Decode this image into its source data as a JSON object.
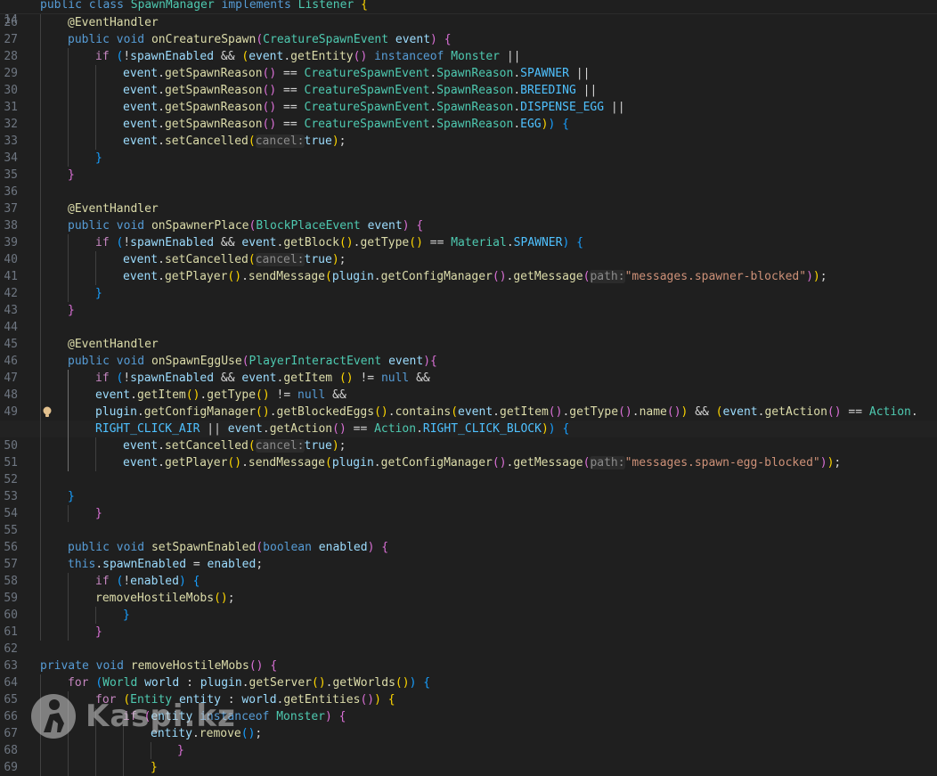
{
  "sticky": {
    "line_number": "14",
    "text": "public class SpawnManager implements Listener {"
  },
  "lines": [
    {
      "n": "26",
      "t": "@EventHandler"
    },
    {
      "n": "27",
      "t": "public void onCreatureSpawn(CreatureSpawnEvent event) {"
    },
    {
      "n": "28",
      "t": "if (!spawnEnabled && (event.getEntity() instanceof Monster ||"
    },
    {
      "n": "29",
      "t": "event.getSpawnReason() == CreatureSpawnEvent.SpawnReason.SPAWNER ||"
    },
    {
      "n": "30",
      "t": "event.getSpawnReason() == CreatureSpawnEvent.SpawnReason.BREEDING ||"
    },
    {
      "n": "31",
      "t": "event.getSpawnReason() == CreatureSpawnEvent.SpawnReason.DISPENSE_EGG ||"
    },
    {
      "n": "32",
      "t": "event.getSpawnReason() == CreatureSpawnEvent.SpawnReason.EGG)) {"
    },
    {
      "n": "33",
      "t": "event.setCancelled(cancel:true);"
    },
    {
      "n": "34",
      "t": "}"
    },
    {
      "n": "35",
      "t": "}"
    },
    {
      "n": "36",
      "t": ""
    },
    {
      "n": "37",
      "t": "@EventHandler"
    },
    {
      "n": "38",
      "t": "public void onSpawnerPlace(BlockPlaceEvent event) {"
    },
    {
      "n": "39",
      "t": "if (!spawnEnabled && event.getBlock().getType() == Material.SPAWNER) {"
    },
    {
      "n": "40",
      "t": "event.setCancelled(cancel:true);"
    },
    {
      "n": "41",
      "t": "event.getPlayer().sendMessage(plugin.getConfigManager().getMessage(path:\"messages.spawner-blocked\"));"
    },
    {
      "n": "42",
      "t": "}"
    },
    {
      "n": "43",
      "t": "}"
    },
    {
      "n": "44",
      "t": ""
    },
    {
      "n": "45",
      "t": "@EventHandler"
    },
    {
      "n": "46",
      "t": "public void onSpawnEggUse(PlayerInteractEvent event){"
    },
    {
      "n": "47",
      "t": "if (!spawnEnabled && event.getItem () != null &&"
    },
    {
      "n": "48",
      "t": "event.getItem().getType() != null &&"
    },
    {
      "n": "49",
      "t": "plugin.getConfigManager().getBlockedEggs().contains(event.getItem().getType().name()) && (event.getAction() == Action."
    },
    {
      "n": "",
      "t": "RIGHT_CLICK_AIR || event.getAction() == Action.RIGHT_CLICK_BLOCK)) {"
    },
    {
      "n": "50",
      "t": "event.setCancelled(cancel:true);"
    },
    {
      "n": "51",
      "t": "event.getPlayer().sendMessage(plugin.getConfigManager().getMessage(path:\"messages.spawn-egg-blocked\"));"
    },
    {
      "n": "52",
      "t": ""
    },
    {
      "n": "53",
      "t": "}"
    },
    {
      "n": "54",
      "t": "}"
    },
    {
      "n": "55",
      "t": ""
    },
    {
      "n": "56",
      "t": "public void setSpawnEnabled(boolean enabled) {"
    },
    {
      "n": "57",
      "t": "this.spawnEnabled = enabled;"
    },
    {
      "n": "58",
      "t": "if (!enabled) {"
    },
    {
      "n": "59",
      "t": "removeHostileMobs();"
    },
    {
      "n": "60",
      "t": "}"
    },
    {
      "n": "61",
      "t": "}"
    },
    {
      "n": "62",
      "t": ""
    },
    {
      "n": "63",
      "t": "private void removeHostileMobs() {"
    },
    {
      "n": "64",
      "t": "for (World world : plugin.getServer().getWorlds()) {"
    },
    {
      "n": "65",
      "t": "for (Entity entity : world.getEntities()) {"
    },
    {
      "n": "66",
      "t": "if (entity instanceof Monster) {"
    },
    {
      "n": "67",
      "t": "entity.remove();"
    },
    {
      "n": "68",
      "t": "}"
    },
    {
      "n": "69",
      "t": "}"
    }
  ],
  "watermark": {
    "text": "Kaspi.kz",
    "icon": "kaspi-logo-icon"
  },
  "colors": {
    "background": "#1f1f1f",
    "keyword": "#569cd6",
    "type": "#4ec9b0",
    "method": "#dcdcaa",
    "variable": "#9cdcfe",
    "string": "#ce9178"
  }
}
